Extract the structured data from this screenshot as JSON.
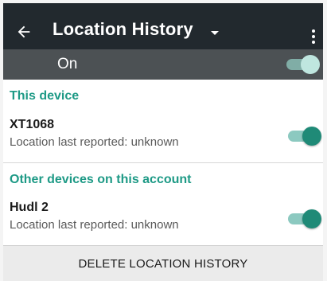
{
  "toolbar": {
    "title": "Location History",
    "back_icon": "arrow-left-icon",
    "dropdown_icon": "caret-down-icon",
    "overflow_icon": "more-vert-icon"
  },
  "master_switch": {
    "label": "On",
    "state": true
  },
  "sections": [
    {
      "header": "This device",
      "devices": [
        {
          "name": "XT1068",
          "status": "Location last reported: unknown",
          "enabled": true
        }
      ]
    },
    {
      "header": "Other devices on this account",
      "devices": [
        {
          "name": "Hudl 2",
          "status": "Location last reported: unknown",
          "enabled": true
        }
      ]
    }
  ],
  "actions": {
    "delete_label": "DELETE LOCATION HISTORY"
  },
  "colors": {
    "toolbar_bg": "#22292e",
    "master_bar_bg": "#4c5154",
    "accent": "#1e9a86",
    "switch_thumb": "#1f8a77"
  }
}
